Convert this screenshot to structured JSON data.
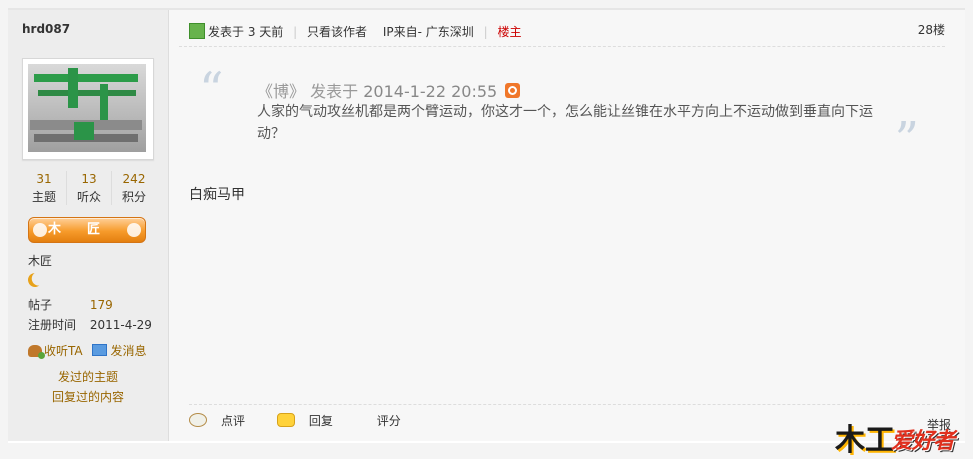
{
  "user": {
    "name": "hrd087",
    "stats": [
      {
        "value": "31",
        "label": "主题"
      },
      {
        "value": "13",
        "label": "听众"
      },
      {
        "value": "242",
        "label": "积分"
      }
    ],
    "rank_badge": "木匠",
    "rank_text": "木匠",
    "posts_label": "帖子",
    "posts_value": "179",
    "reg_label": "注册时间",
    "reg_value": "2011-4-29",
    "action_follow": "收听TA",
    "action_message": "发消息",
    "link_topics": "发过的主题",
    "link_replies": "回复过的内容"
  },
  "post": {
    "posted_prefix": "发表于",
    "posted_time": "3 天前",
    "only_author": "只看该作者",
    "ip_info": "IP来自- 广东深圳",
    "op_label": "楼主",
    "floor": "28楼",
    "quote": {
      "author": "《博》",
      "posted_label": "发表于",
      "date": "2014-1-22 20:55",
      "body": "人家的气动攻丝机都是两个臂运动，你这才一个，怎么能让丝锥在水平方向上不运动做到垂直向下运动？"
    },
    "content": "白痴马甲",
    "footer": {
      "comment": "点评",
      "reply": "回复",
      "rate": "评分",
      "report": "举报"
    }
  },
  "logo": {
    "part1": "木工",
    "part2": "爱好者"
  },
  "colors": {
    "accent": "#996600",
    "op": "#cc0000",
    "badge": "#f79b2b"
  }
}
